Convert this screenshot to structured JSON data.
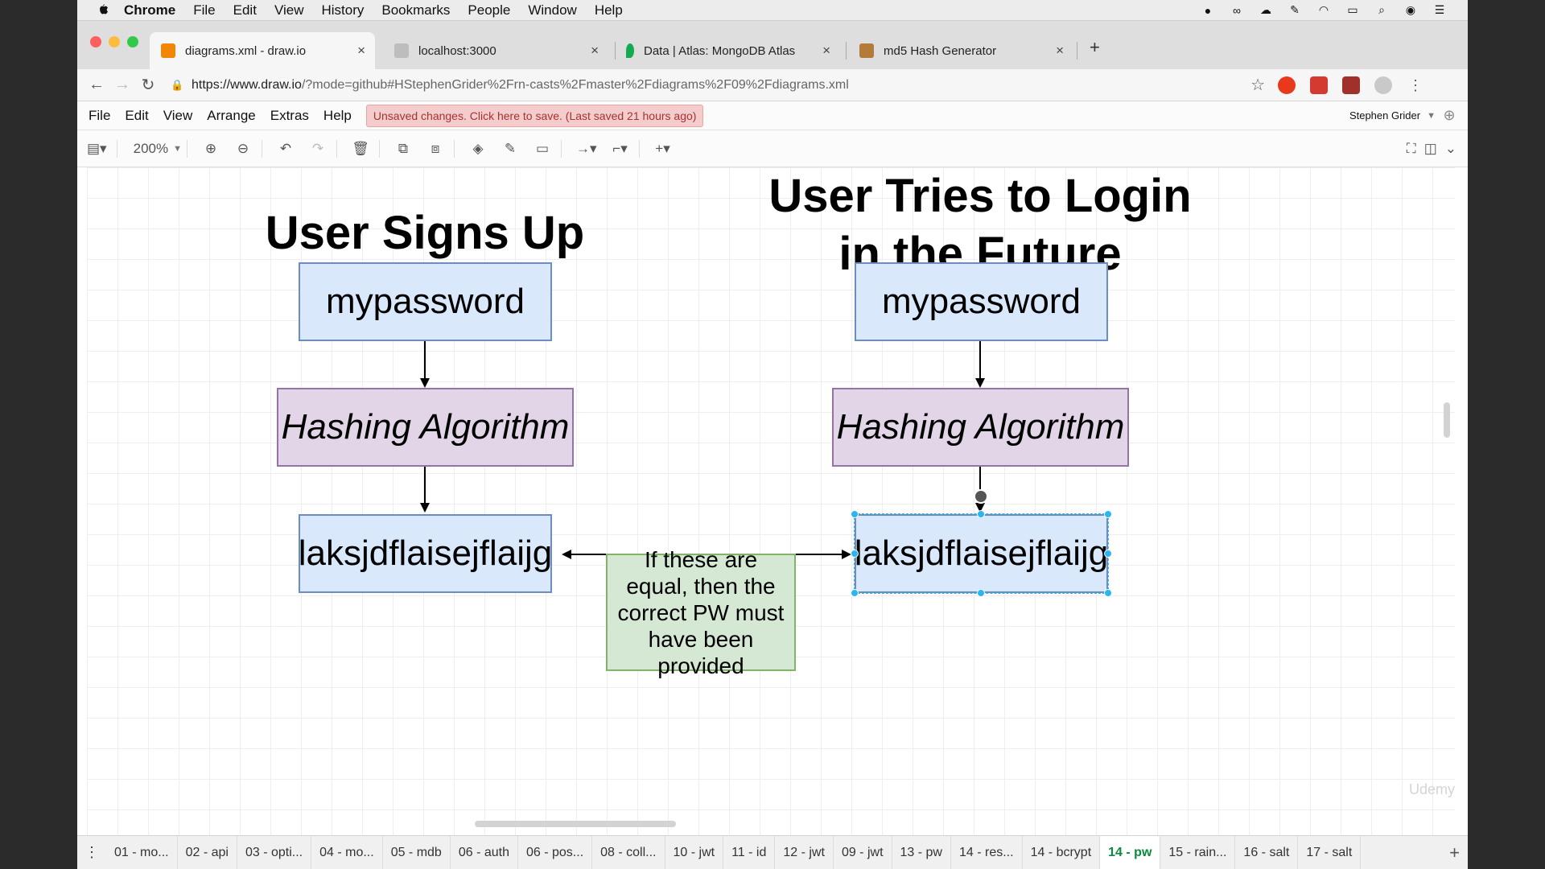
{
  "os_menubar": {
    "app": "Chrome",
    "items": [
      "File",
      "Edit",
      "View",
      "History",
      "Bookmarks",
      "People",
      "Window",
      "Help"
    ]
  },
  "tabs": [
    {
      "label": "diagrams.xml - draw.io",
      "favicon_color": "#f08705"
    },
    {
      "label": "localhost:3000",
      "favicon_color": "#9a9a9a"
    },
    {
      "label": "Data | Atlas: MongoDB Atlas",
      "favicon_color": "#13aa52"
    },
    {
      "label": "md5 Hash Generator",
      "favicon_color": "#b37a3a"
    }
  ],
  "address": {
    "url_host": "https://www.draw.io",
    "url_rest": "/?mode=github#HStephenGrider%2Frn-casts%2Fmaster%2Fdiagrams%2F09%2Fdiagrams.xml"
  },
  "drawio_menu": {
    "items": [
      "File",
      "Edit",
      "View",
      "Arrange",
      "Extras",
      "Help"
    ],
    "unsaved_notice": "Unsaved changes. Click here to save. (Last saved 21 hours ago)",
    "user": "Stephen Grider"
  },
  "toolbar": {
    "zoom": "200%"
  },
  "diagram": {
    "left": {
      "title": "User Signs Up",
      "password": "mypassword",
      "algorithm": "Hashing Algorithm",
      "hash": "laksjdflaisejflaijg"
    },
    "right": {
      "title_line1": "User Tries to Login",
      "title_line2": "in the Future",
      "password": "mypassword",
      "algorithm": "Hashing Algorithm",
      "hash": "laksjdflaisejflaijg"
    },
    "note": "If these are equal, then the correct PW must have been provided",
    "watermark": "Udemy"
  },
  "page_tabs": [
    "01 - mo...",
    "02 - api",
    "03 - opti...",
    "04 - mo...",
    "05 - mdb",
    "06 - auth",
    "06 - pos...",
    "08 - coll...",
    "10 - jwt",
    "11 - id",
    "12 - jwt",
    "09 - jwt",
    "13 - pw",
    "14 - res...",
    "14 - bcrypt",
    "14 - pw",
    "15 - rain...",
    "16 - salt",
    "17 - salt"
  ],
  "active_page_index": 15
}
